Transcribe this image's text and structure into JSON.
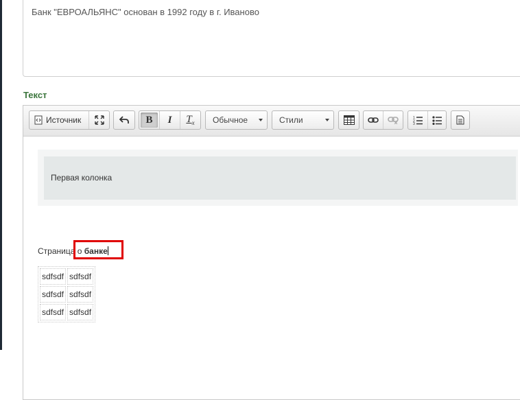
{
  "description": {
    "text": "Банк \"ЕВРОАЛЬЯНС\" основан в 1992 году в г. Иваново"
  },
  "field_label": "Текст",
  "toolbar": {
    "source_label": "Источник",
    "format_combo": "Обычное",
    "styles_combo": "Стили",
    "icons": [
      "source-icon",
      "maximize-icon",
      "undo-icon",
      "bold-icon",
      "italic-icon",
      "remove-format-icon",
      "table-icon",
      "link-icon",
      "unlink-icon",
      "numbered-list-icon",
      "bulleted-list-icon",
      "templates-icon"
    ]
  },
  "content": {
    "block_text": "Первая колонка",
    "page_prefix": "Страница о ",
    "page_bold": "банке",
    "table": [
      [
        "sdfsdf",
        "sdfsdf"
      ],
      [
        "sdfsdf",
        "sdfsdf"
      ],
      [
        "sdfsdf",
        "sdfsdf"
      ]
    ]
  },
  "colors": {
    "label_green": "#3c763d",
    "highlight_red": "#e00000"
  }
}
